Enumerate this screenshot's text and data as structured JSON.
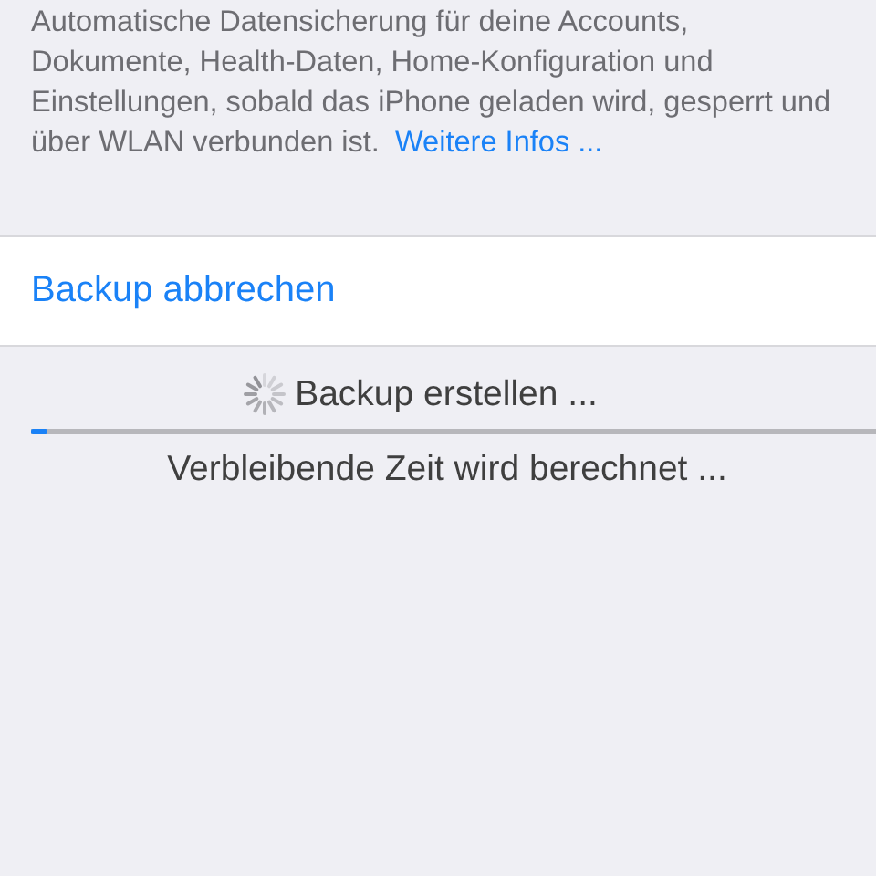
{
  "footer": {
    "text": "Automatische Datensicherung für deine Accounts, Dokumente, Health-Daten, Home-Konfiguration und Einstellungen, sobald das iPhone geladen wird, gesperrt und über WLAN verbunden ist.",
    "link": "Weitere Infos ..."
  },
  "action": {
    "label": "Backup abbrechen"
  },
  "progress": {
    "status": "Backup erstellen ...",
    "level": 0.02,
    "detail": "Verbleibende Zeit wird berechnet ..."
  }
}
